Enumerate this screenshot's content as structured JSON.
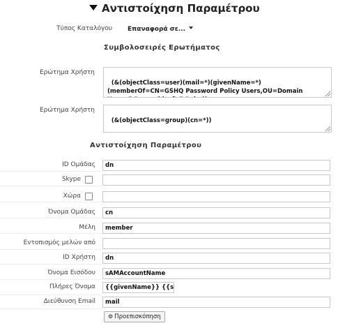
{
  "header": {
    "title": "Αντιστοίχηση Παραμέτρου"
  },
  "catalog": {
    "label": "Τύπος Καταλόγου",
    "selected": "Επαναφορά σε..."
  },
  "query_section": {
    "title": "Συμβολοσειρές Ερωτήματος",
    "user_query_label": "Ερώτημα Χρήστη",
    "user_query_value": "(&(objectClass=user)(mail=*)(givenName=*)(memberOf=CN=GSHQ Password Policy Users,OU=Domain Users,DC=graphisoft,DC=hu))",
    "group_query_label": "Ερώτημα Χρήστη",
    "group_query_value": "(&(objectClass=group)(cn=*))"
  },
  "mapping_section": {
    "title": "Αντιστοίχηση Παραμέτρου",
    "fields": [
      {
        "label": "ID Ομάδας",
        "value": "dn",
        "type": "text"
      },
      {
        "label": "Skype",
        "value": "",
        "type": "checkbox"
      },
      {
        "label": "Χώρα",
        "value": "",
        "type": "checkbox"
      },
      {
        "label": "Όνομα Ομάδας",
        "value": "cn",
        "type": "text"
      },
      {
        "label": "Μέλη",
        "value": "member",
        "type": "text"
      },
      {
        "label": "Εντοπισμός μελών από",
        "value": "",
        "type": "text"
      },
      {
        "label": "ID Χρήστη",
        "value": "dn",
        "type": "text"
      },
      {
        "label": "Όνομα Εισόδου",
        "value": "sAMAccountName",
        "type": "text"
      },
      {
        "label": "Πλήρες Όνομα",
        "value": "{{givenName}} {{sn}}",
        "type": "text"
      },
      {
        "label": "Διεύθυνση Email",
        "value": "mail",
        "type": "text"
      }
    ]
  },
  "preview_button": {
    "label": "Προεπισκόπηση",
    "icon": "gear-icon"
  }
}
